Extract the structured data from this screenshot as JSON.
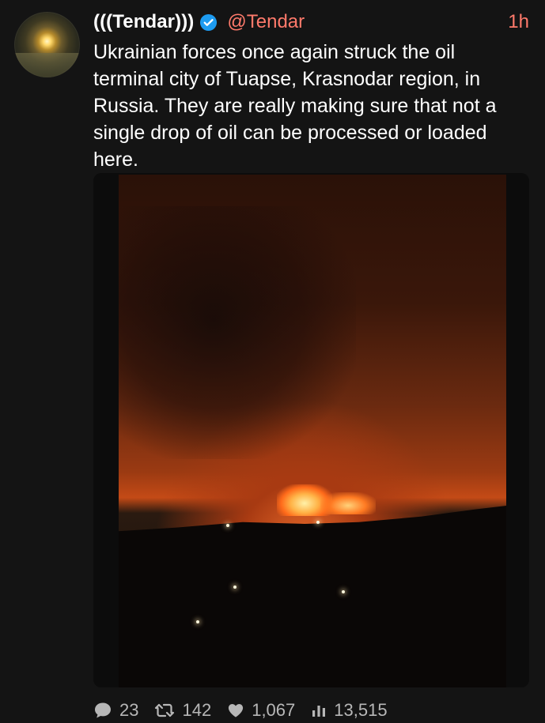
{
  "tweet": {
    "display_name": "(((Tendar)))",
    "handle": "@Tendar",
    "timestamp": "1h",
    "text": "Ukrainian forces once again struck the oil terminal city of Tuapse, Krasnodar region, in Russia. They are really making sure that not a single drop of oil can be processed or loaded here.",
    "verified": true
  },
  "actions": {
    "replies": "23",
    "retweets": "142",
    "likes": "1,067",
    "views": "13,515"
  },
  "icons": {
    "verified": "verified-badge-icon",
    "reply": "speech-bubble-icon",
    "retweet": "retweet-icon",
    "like": "heart-icon",
    "views": "bar-chart-icon"
  },
  "colors": {
    "background": "#141414",
    "accent": "#ff7a6b",
    "verified": "#1d9bf0",
    "text": "#ffffff",
    "muted": "#b7b7b7"
  }
}
